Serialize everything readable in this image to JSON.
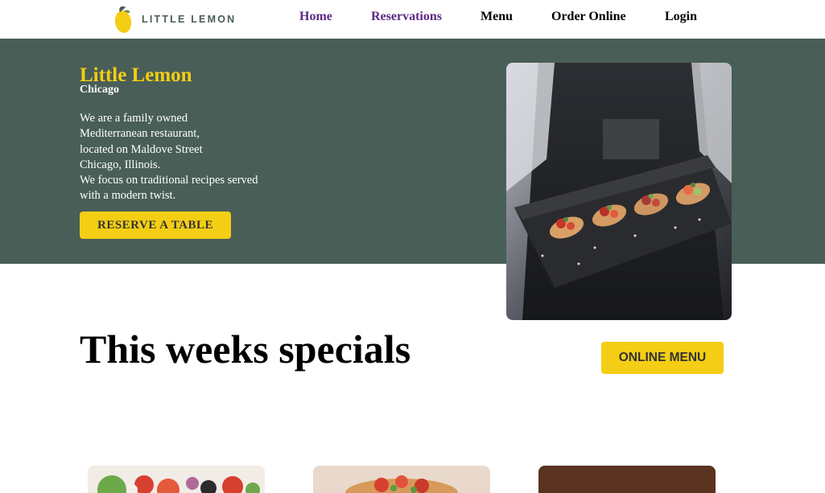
{
  "header": {
    "logo_text": "LITTLE LEMON",
    "nav": [
      {
        "label": "Home",
        "state": "visited"
      },
      {
        "label": "Reservations",
        "state": "visited"
      },
      {
        "label": "Menu",
        "state": "default"
      },
      {
        "label": "Order Online",
        "state": "default"
      },
      {
        "label": "Login",
        "state": "default"
      }
    ]
  },
  "hero": {
    "title": "Little Lemon",
    "subtitle": "Chicago",
    "description_lines": [
      "We are a family owned",
      "Mediterranean restaurant,",
      "located on Maldove Street",
      "Chicago, Illinois.",
      "We focus on traditional recipes served",
      "with a modern twist."
    ],
    "reserve_label": "RESERVE A TABLE",
    "photo_icon": "bruschetta-platter-photo"
  },
  "specials": {
    "title": "This weeks specials",
    "online_menu_label": "ONLINE MENU",
    "cards": [
      {
        "image_icon": "greek-salad-photo"
      },
      {
        "image_icon": "bruschetta-photo"
      },
      {
        "image_icon": "lemon-dessert-photo"
      }
    ]
  },
  "colors": {
    "primary_green": "#495e57",
    "primary_yellow": "#f4ce14",
    "visited_link": "#5b2a86",
    "dark_text": "#333333"
  }
}
